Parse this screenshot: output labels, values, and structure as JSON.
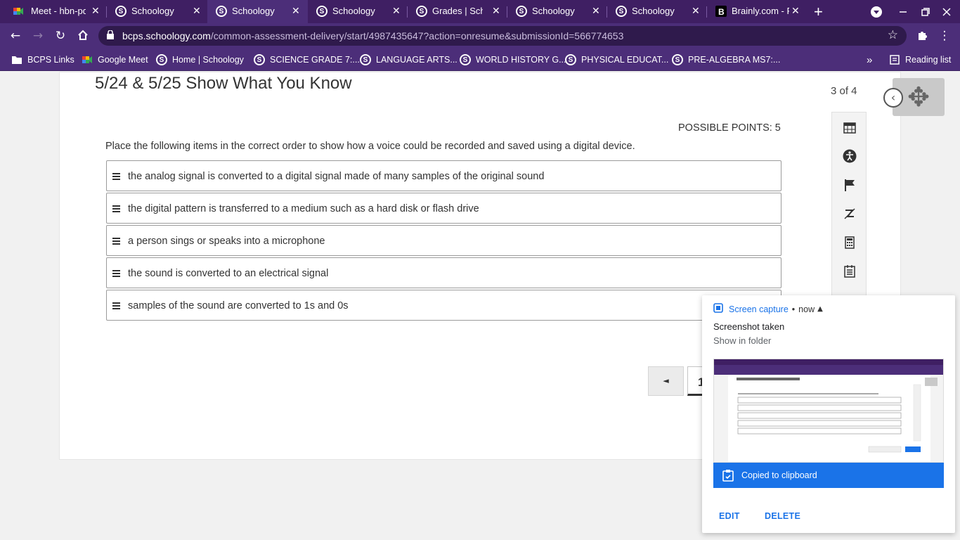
{
  "tabs": [
    {
      "title": "Meet - hbn-pdq",
      "favicon": "meet-icon",
      "active": false
    },
    {
      "title": "Schoology",
      "favicon": "schoology-icon",
      "active": false
    },
    {
      "title": "Schoology",
      "favicon": "schoology-icon",
      "active": true
    },
    {
      "title": "Schoology",
      "favicon": "schoology-icon",
      "active": false
    },
    {
      "title": "Grades | Schoology",
      "favicon": "schoology-icon",
      "active": false
    },
    {
      "title": "Schoology",
      "favicon": "schoology-icon",
      "active": false
    },
    {
      "title": "Schoology",
      "favicon": "schoology-icon",
      "active": false
    },
    {
      "title": "Brainly.com - For students. By students.",
      "favicon": "brainly-icon",
      "active": false
    }
  ],
  "new_tab_glyph": "+",
  "close_glyph": "✕",
  "address": {
    "host": "bcps.schoology.com",
    "path": "/common-assessment-delivery/start/4987435647?action=onresume&submissionId=566774653"
  },
  "bookmarks": {
    "items": [
      {
        "label": "BCPS Links",
        "icon": "folder-icon"
      },
      {
        "label": "Google Meet",
        "icon": "meet-icon"
      },
      {
        "label": "Home | Schoology",
        "icon": "schoology-icon"
      },
      {
        "label": "SCIENCE GRADE 7:...",
        "icon": "schoology-icon"
      },
      {
        "label": "LANGUAGE ARTS...",
        "icon": "schoology-icon"
      },
      {
        "label": "WORLD HISTORY G...",
        "icon": "schoology-icon"
      },
      {
        "label": "PHYSICAL EDUCAT...",
        "icon": "schoology-icon"
      },
      {
        "label": "PRE-ALGEBRA MS7:...",
        "icon": "schoology-icon"
      }
    ],
    "overflow": "»",
    "reading_list": "Reading list"
  },
  "assessment": {
    "title": "5/24 & 5/25 Show What You Know",
    "counter": "3 of 4",
    "points": "POSSIBLE POINTS: 5",
    "prompt": "Place the following items in the correct order to show how a voice could be recorded and saved using a digital device.",
    "items": [
      "the analog signal is converted to a digital signal made of many samples of the original sound",
      "the digital pattern is transferred to a medium such as a hard disk or flash drive",
      "a person sings or speaks into a microphone",
      "the sound is converted to an electrical signal",
      "samples of the sound are converted to 1s and 0s"
    ],
    "pager_prev": "◄",
    "current_page": "1"
  },
  "toolbar": {
    "tools": [
      "calendar-icon",
      "accessibility-icon",
      "flag-icon",
      "eliminate-icon",
      "calculator-icon",
      "notepad-icon"
    ]
  },
  "notification": {
    "app": "Screen capture",
    "time": "now",
    "title": "Screenshot taken",
    "subtitle": "Show in folder",
    "copied": "Copied to clipboard",
    "edit": "EDIT",
    "delete": "DELETE"
  },
  "colors": {
    "browser_frame": "#3f1f63",
    "browser_toolbar": "#4c2e79",
    "accent_blue": "#1a73e8"
  }
}
